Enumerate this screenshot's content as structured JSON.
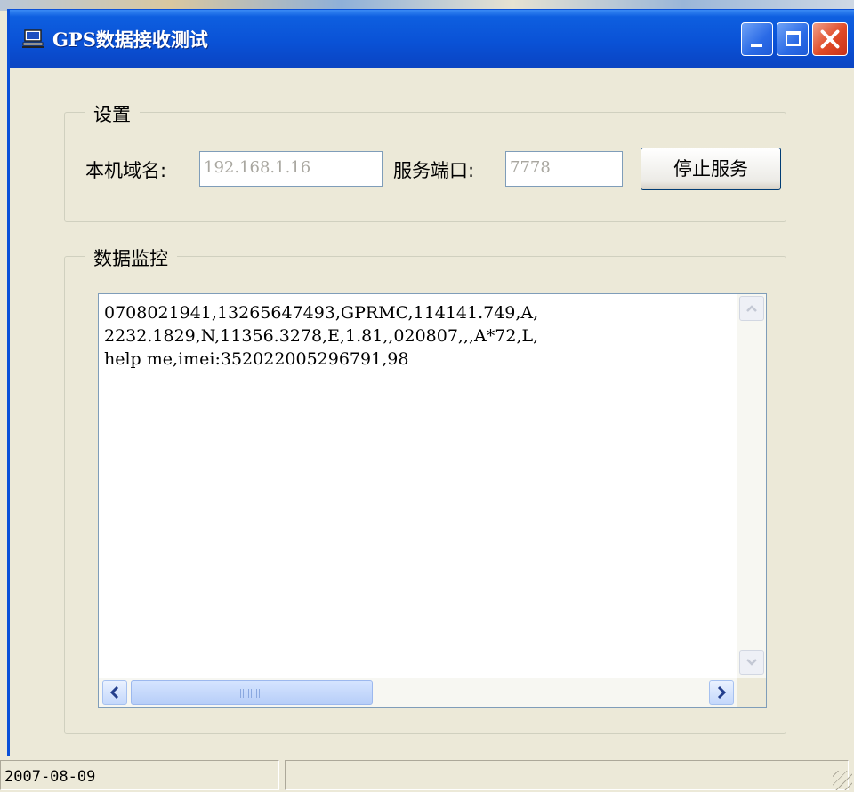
{
  "window": {
    "title": "GPS数据接收测试"
  },
  "settings": {
    "group_label": "设置",
    "hostname_label": "本机域名:",
    "hostname_value": "192.168.1.16",
    "port_label": "服务端口:",
    "port_value": "7778",
    "stop_button": "停止服务"
  },
  "monitor": {
    "group_label": "数据监控",
    "lines": [
      "0708021941,13265647493,GPRMC,114141.749,A,",
      "2232.1829,N,11356.3278,E,1.81,,020807,,,A*72,L,",
      "help me,imei:352022005296791,98"
    ]
  },
  "statusbar": {
    "date": "2007-08-09"
  },
  "colors": {
    "titlebar": "#0A52D6",
    "face": "#ECE9D8",
    "close": "#E04A26"
  },
  "icons": [
    "app-computer-icon",
    "minimize-icon",
    "maximize-icon",
    "close-icon",
    "scroll-up-icon",
    "scroll-down-icon",
    "scroll-left-icon",
    "scroll-right-icon"
  ]
}
